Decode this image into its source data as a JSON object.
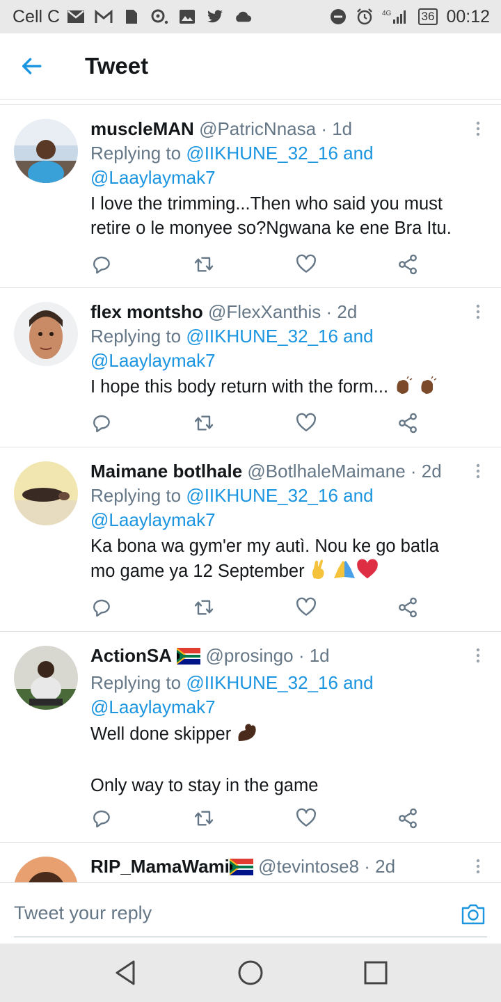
{
  "status_bar": {
    "carrier": "Cell C",
    "network": "4G",
    "battery": "36",
    "time": "00:12"
  },
  "header": {
    "title": "Tweet"
  },
  "tweets": [
    {
      "name": "muscleMAN",
      "handle": "@PatricNnasa",
      "time": "· 1d",
      "replying_prefix": "Replying to ",
      "mention1": "@IIKHUNE_32_16",
      "and": " and",
      "mention2": "@Laaylaymak7",
      "text": "I love the trimming...Then who said you must retire o le monyee so?Ngwana ke ene Bra Itu."
    },
    {
      "name": "flex montsho",
      "handle": "@FlexXanthis",
      "time": "· 2d",
      "replying_prefix": "Replying to ",
      "mention1": "@IIKHUNE_32_16",
      "and": " and",
      "mention2": "@Laaylaymak7",
      "text": "I hope this body return with the form..."
    },
    {
      "name": "Maimane botlhale",
      "handle": "@BotlhaleMaimane",
      "time": "· 2d",
      "replying_prefix": "Replying to ",
      "mention1": "@IIKHUNE_32_16",
      "and": " and",
      "mention2": "@Laaylaymak7",
      "text": "Ka bona wa gym'er my autì. Nou ke go batla mo game ya 12 September"
    },
    {
      "name": "ActionSA",
      "handle": "@prosingo",
      "time": "· 1d",
      "replying_prefix": "Replying to ",
      "mention1": "@IIKHUNE_32_16",
      "and": " and",
      "mention2": "@Laaylaymak7",
      "text": "Well done skipper",
      "text2": "Only way to stay in the game"
    },
    {
      "name": "RIP_MamaWami",
      "handle": "@tevintose8",
      "time": "· 2d"
    }
  ],
  "reply": {
    "placeholder": "Tweet your reply"
  },
  "colors": {
    "accent": "#1b95e0",
    "secondary_text": "#657786",
    "divider": "#dde2e6"
  }
}
